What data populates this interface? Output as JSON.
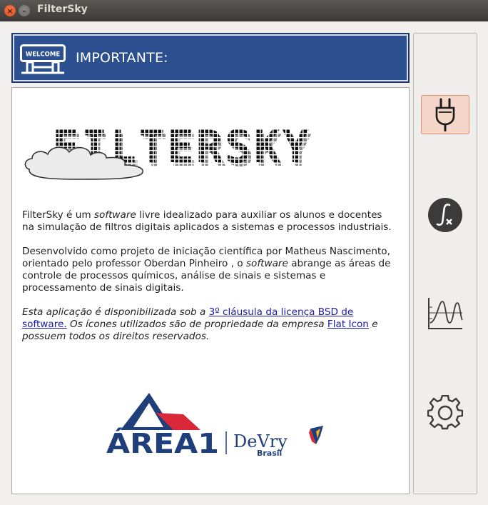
{
  "window": {
    "title": "FilterSky",
    "close_glyph": "×",
    "minimize_glyph": "–"
  },
  "banner": {
    "title": "IMPORTANTE:",
    "sign_text": "WELCOME",
    "sign_icon": "welcome-sign-icon"
  },
  "logo": {
    "text": "FILTERSKY",
    "icon": "cloud-icon"
  },
  "content": {
    "p1": {
      "a": "FilterSky é um ",
      "b": "software",
      "c": " livre idealizado para auxiliar os alunos e docentes na simulação de filtros digitais aplicados a sistemas e processos industriais."
    },
    "p2": {
      "a": "Desenvolvido como projeto de iniciação científica por Matheus Nascimento, orientado pelo professor Oberdan Pinheiro , o ",
      "b": "software",
      "c": " abrange  as áreas de controle de processos químicos, análise de sinais e sistemas e processamento de sinais digitais."
    },
    "p3": {
      "a": "Esta aplicação é disponibilizada sob a ",
      "link1": "3º cláusula da licença BSD de software.",
      "b": " Os ícones utilizados são de propriedade da empresa ",
      "link2": "Flat Icon",
      "c": " e possuem todos os direitos reservados."
    }
  },
  "sponsor": {
    "area1": "ÁREA1",
    "devry": "DeVry",
    "brasil": "Brasil"
  },
  "sidebar": {
    "items": [
      {
        "icon": "plug-icon",
        "active": true
      },
      {
        "icon": "function-icon",
        "active": false
      },
      {
        "icon": "signal-chart-icon",
        "active": false
      },
      {
        "icon": "gear-icon",
        "active": false
      }
    ]
  },
  "colors": {
    "banner": "#2c4f8f",
    "active": "#f4d6c9",
    "link": "#1a1aa6"
  }
}
